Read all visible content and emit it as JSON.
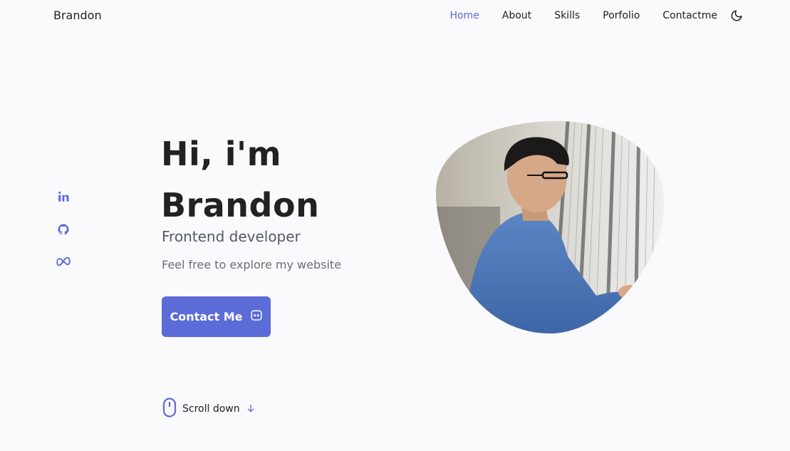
{
  "header": {
    "brand": "Brandon",
    "nav": [
      {
        "label": "Home",
        "active": true
      },
      {
        "label": "About",
        "active": false
      },
      {
        "label": "Skills",
        "active": false
      },
      {
        "label": "Porfolio",
        "active": false
      },
      {
        "label": "Contactme",
        "active": false
      }
    ],
    "theme_toggle_icon": "moon-icon"
  },
  "socials": [
    {
      "icon": "linkedin-icon"
    },
    {
      "icon": "github-icon"
    },
    {
      "icon": "meta-icon"
    }
  ],
  "hero": {
    "title_line1": "Hi, i'm",
    "title_line2": "Brandon",
    "subtitle": "Frontend developer",
    "description": "Feel free to explore my website",
    "contact_label": "Contact Me",
    "contact_icon": "message-icon",
    "scroll_label": "Scroll down",
    "scroll_icon": "mouse-icon",
    "scroll_arrow_icon": "arrow-down-icon",
    "image": "profile-photo"
  },
  "colors": {
    "accent": "#5b6bd8",
    "background": "#fafafc",
    "text": "#222222"
  }
}
